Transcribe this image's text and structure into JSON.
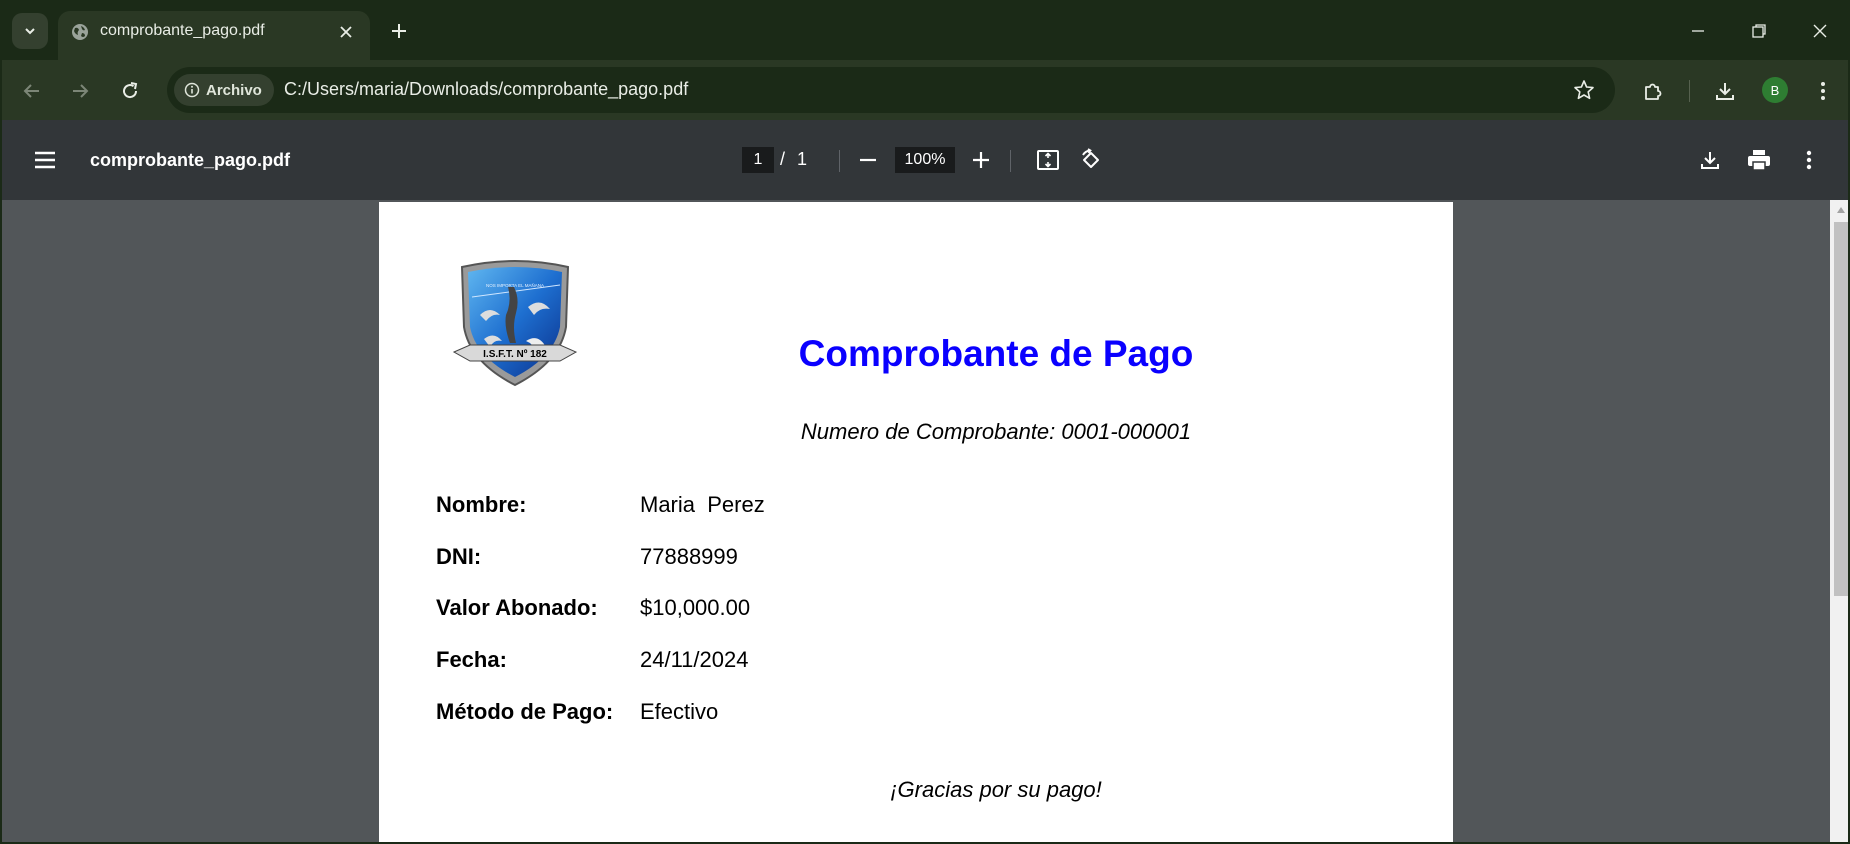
{
  "tab": {
    "title": "comprobante_pago.pdf"
  },
  "address_bar": {
    "site_chip_label": "Archivo",
    "url": "C:/Users/maria/Downloads/comprobante_pago.pdf"
  },
  "profile": {
    "initial": "B",
    "color": "#2e7d32"
  },
  "pdf_viewer": {
    "file_name": "comprobante_pago.pdf",
    "current_page": "1",
    "page_separator": "/",
    "total_pages": "1",
    "zoom": "100%"
  },
  "document": {
    "title": "Comprobante de Pago",
    "title_color": "#0a00ff",
    "number_line": "Numero de Comprobante: 0001-000001",
    "logo_text": "I.S.F.T. Nº 182",
    "logo_motto": "NOS IMPORTA EL MAÑANA",
    "fields": [
      {
        "label": "Nombre:",
        "value": "Maria  Perez"
      },
      {
        "label": "DNI:",
        "value": "77888999"
      },
      {
        "label": "Valor Abonado:",
        "value": "$10,000.00"
      },
      {
        "label": "Fecha:",
        "value": "24/11/2024"
      },
      {
        "label": "Método de Pago:",
        "value": "Efectivo"
      }
    ],
    "thanks": "¡Gracias por su pago!"
  },
  "icons": {
    "tab_search": "chevron-down-icon",
    "favicon": "globe-icon",
    "tab_close": "close-icon",
    "new_tab": "plus-icon",
    "back": "arrow-left-icon",
    "forward": "arrow-right-icon",
    "reload": "reload-icon",
    "site_info": "info-icon",
    "bookmark": "star-icon",
    "extensions": "puzzle-icon",
    "downloads": "download-icon",
    "browser_menu": "kebab-icon",
    "pdf_menu": "hamburger-icon",
    "zoom_out": "minus-icon",
    "zoom_in": "plus-icon",
    "fit_page": "fit-page-icon",
    "rotate": "rotate-icon",
    "pdf_download": "download-icon",
    "print": "printer-icon",
    "pdf_more": "kebab-icon"
  }
}
